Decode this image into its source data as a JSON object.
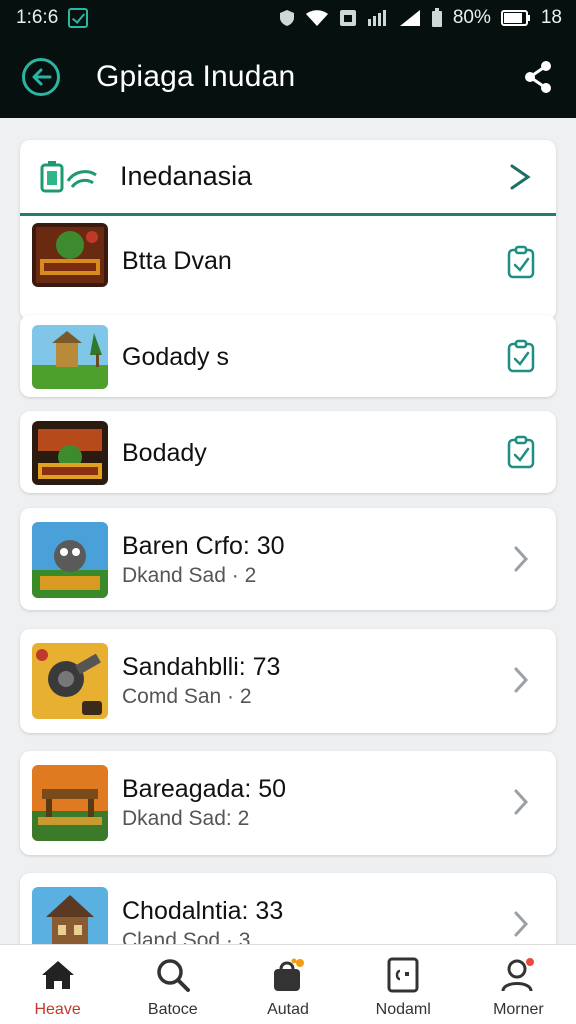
{
  "status": {
    "time": "1:6:6",
    "battery": "80%",
    "extra": "18",
    "icons": [
      "check-box-icon",
      "shield-icon",
      "wifi-icon",
      "image-icon",
      "cell-bars-icon",
      "signal-icon",
      "battery-small-icon",
      "battery-icon"
    ]
  },
  "appbar": {
    "title": "Gpiaga Inudan"
  },
  "section": {
    "title": "Inedanasia"
  },
  "items": [
    {
      "title": "Btta Dvan",
      "subtitle": "",
      "action": "check"
    },
    {
      "title": "Godady s",
      "subtitle": "",
      "action": "check"
    },
    {
      "title": "Bodady",
      "subtitle": "",
      "action": "check"
    },
    {
      "title": "Baren Crfo: 30",
      "subtitle": "Dkand Sad · 2",
      "action": "chevron"
    },
    {
      "title": "Sandahblli: 73",
      "subtitle": "Comd San · 2",
      "action": "chevron"
    },
    {
      "title": "Bareagada: 50",
      "subtitle": "Dkand Sad: 2",
      "action": "chevron"
    },
    {
      "title": "Chodalntia: 33",
      "subtitle": "Cland Sod · 3",
      "action": "chevron"
    }
  ],
  "nav": [
    {
      "label": "Heave",
      "icon": "home-icon",
      "active": true
    },
    {
      "label": "Batoce",
      "icon": "search-icon",
      "active": false
    },
    {
      "label": "Autad",
      "icon": "bag-icon",
      "active": false
    },
    {
      "label": "Nodaml",
      "icon": "tablet-icon",
      "active": false
    },
    {
      "label": "Morner",
      "icon": "profile-icon",
      "active": false
    }
  ],
  "colors": {
    "accent": "#1f8f84",
    "active": "#c0392b",
    "topbar": "#06100f"
  }
}
